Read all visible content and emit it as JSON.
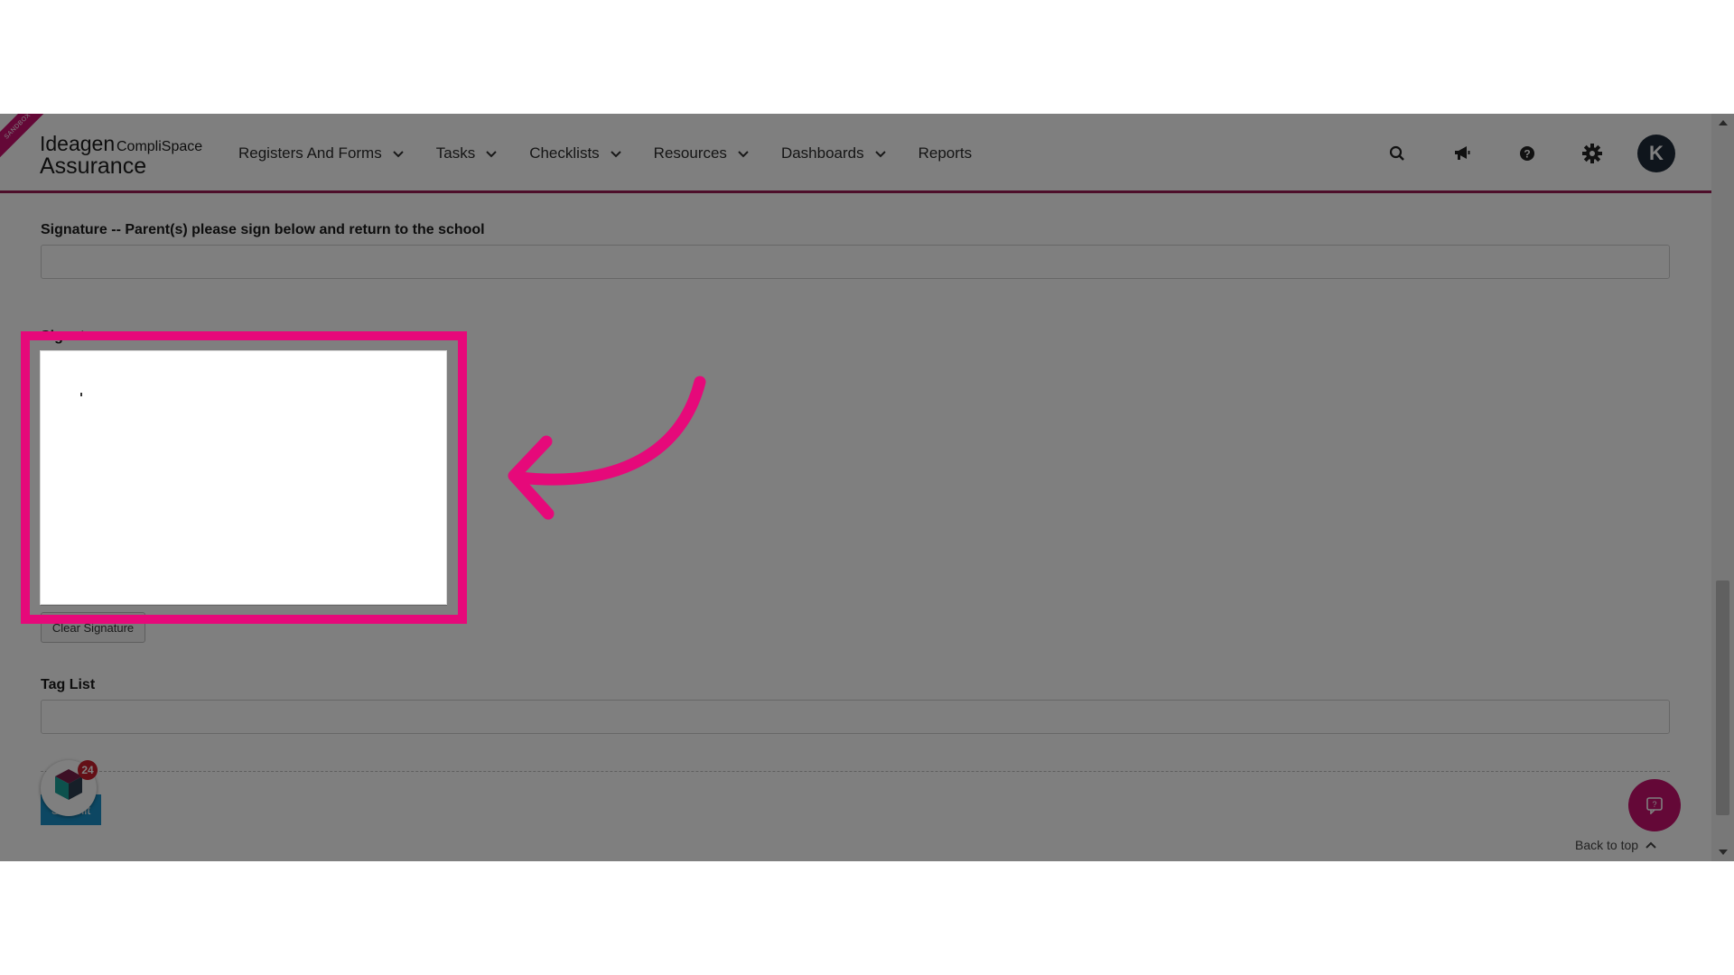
{
  "header": {
    "ribbon_label": "SANDBOX",
    "logo": {
      "brand": "Ideagen",
      "sub_brand": "CompliSpace",
      "product": "Assurance"
    },
    "nav": [
      {
        "label": "Registers And Forms",
        "has_dropdown": true
      },
      {
        "label": "Tasks",
        "has_dropdown": true
      },
      {
        "label": "Checklists",
        "has_dropdown": true
      },
      {
        "label": "Resources",
        "has_dropdown": true
      },
      {
        "label": "Dashboards",
        "has_dropdown": true
      },
      {
        "label": "Reports",
        "has_dropdown": false
      }
    ],
    "icons": [
      "search-icon",
      "megaphone-icon",
      "help-icon",
      "gear-icon"
    ],
    "avatar_initial": "K",
    "accent_color": "#9b1d55"
  },
  "form": {
    "signature_text_label": "Signature -- Parent(s) please sign below and return to the school",
    "signature_text_value": "",
    "signature_pad_label": "Signature",
    "clear_signature_label": "Clear Signature",
    "tag_list_label": "Tag List",
    "tag_list_value": "",
    "submit_label": "Submit"
  },
  "widgets": {
    "notification_count": "24",
    "back_to_top_label": "Back to top",
    "help_fab_color": "#c8106e"
  },
  "annotation": {
    "highlight_color": "#e6097a"
  }
}
